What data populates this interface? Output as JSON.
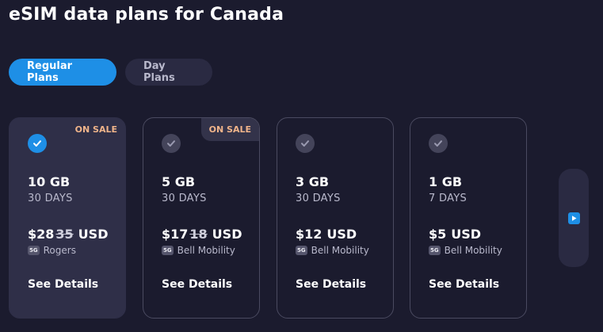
{
  "page": {
    "title": "eSIM data plans for Canada"
  },
  "tabs": [
    {
      "label": "Regular Plans",
      "active": true
    },
    {
      "label": "Day Plans",
      "active": false
    }
  ],
  "plans": [
    {
      "badge": "ON SALE",
      "data": "10 GB",
      "duration": "30 DAYS",
      "price": "$28",
      "old_price": "35",
      "currency": "USD",
      "network_badge": "5G",
      "operator": "Rogers",
      "details": "See Details",
      "selected": true
    },
    {
      "badge": "ON SALE",
      "data": "5 GB",
      "duration": "30 DAYS",
      "price": "$17",
      "old_price": "18",
      "currency": "USD",
      "network_badge": "5G",
      "operator": "Bell Mobility",
      "details": "See Details",
      "selected": false
    },
    {
      "data": "3 GB",
      "duration": "30 DAYS",
      "price": "$12",
      "currency": "USD",
      "network_badge": "5G",
      "operator": "Bell Mobility",
      "details": "See Details",
      "selected": false
    },
    {
      "data": "1 GB",
      "duration": "7 DAYS",
      "price": "$5",
      "currency": "USD",
      "network_badge": "5G",
      "operator": "Bell Mobility",
      "details": "See Details",
      "selected": false
    }
  ],
  "scroller": {
    "icon": "play-icon"
  },
  "colors": {
    "accent": "#1e8fe6",
    "sale": "#f0b48a",
    "background": "#1b1b2e"
  }
}
